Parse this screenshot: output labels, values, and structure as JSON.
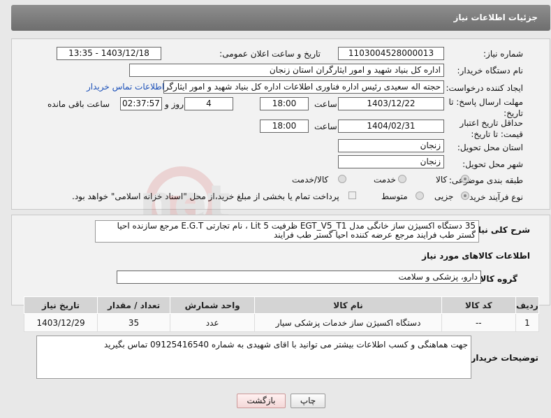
{
  "header": {
    "title": "جزئیات اطلاعات نیاز"
  },
  "form": {
    "need_number_label": "شماره نیاز:",
    "need_number": "1103004528000013",
    "announce_label": "تاریخ و ساعت اعلان عمومی:",
    "announce_value": "1403/12/18 - 13:35",
    "buyer_label": "نام دستگاه خریدار:",
    "buyer_value": "اداره کل بنیاد شهید و امور ایثارگران استان زنجان",
    "creator_label": "ایجاد کننده درخواست:",
    "creator_value": "حجته اله سعیدی رئیس اداره فناوری اطلاعات  اداره کل بنیاد شهید و امور ایثارگرا",
    "contact_link": "اطلاعات تماس خریدار",
    "deadline_label": "مهلت ارسال پاسخ: تا تاریخ:",
    "deadline_date": "1403/12/22",
    "time_label": "ساعت",
    "deadline_time": "18:00",
    "days_value": "4",
    "days_label": "روز و",
    "remaining_value": "02:37:57",
    "remaining_label": "ساعت باقی مانده",
    "validity_label": "حداقل تاریخ اعتبار قیمت: تا تاریخ:",
    "validity_date": "1404/02/31",
    "validity_time": "18:00",
    "province_label": "استان محل تحویل:",
    "province_value": "زنجان",
    "city_label": "شهر محل تحویل:",
    "city_value": "زنجان",
    "category_label": "طبقه بندی موضوعی:",
    "category_options": [
      "کالا",
      "خدمت",
      "کالا/خدمت"
    ],
    "category_selected": "کالا",
    "process_label": "نوع فرآیند خرید :",
    "process_options": [
      "جزیی",
      "متوسط"
    ],
    "process_selected": "جزیی",
    "payment_note": "پرداخت تمام یا بخشی از مبلغ خرید،از محل \"اسناد خزانه اسلامی\" خواهد بود."
  },
  "description": {
    "label": "شرح کلی نیاز:",
    "text": "35 دستگاه اکسیژن  ساز خانگی مدل EGT_V5_T1 ظرفیت  Lit 5  ، نام تجارتی E.G.T مرجع سازنده احیا گستر طب فرایند مرجع عرضه کننده احیا گستر طب فرایند"
  },
  "goods_section": {
    "title": "اطلاعات کالاهای مورد نیاز",
    "group_label": "گروه کالا:",
    "group_value": "دارو، پزشکی و سلامت"
  },
  "table": {
    "headers": [
      "ردیف",
      "کد کالا",
      "نام کالا",
      "واحد شمارش",
      "تعداد / مقدار",
      "تاریخ نیاز"
    ],
    "rows": [
      [
        "1",
        "--",
        "دستگاه اکسیژن ساز خدمات پزشکی سیار",
        "عدد",
        "35",
        "1403/12/29"
      ]
    ]
  },
  "buyer_notes": {
    "label": "توضیحات خریدار:",
    "text": "جهت هماهنگی و کسب اطلاعات بیشتر می توانید با اقای شهیدی به شماره 09125416540  تماس بگیرید"
  },
  "buttons": {
    "print": "چاپ",
    "back": "بازگشت"
  }
}
